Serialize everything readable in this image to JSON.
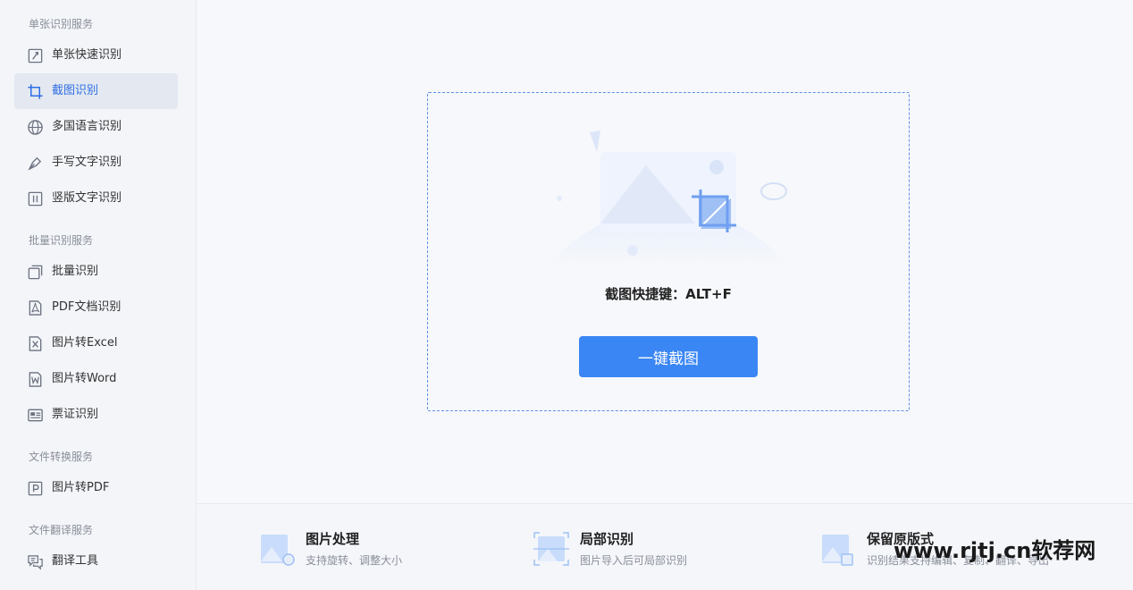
{
  "sidebar": {
    "sections": [
      {
        "title": "单张识别服务",
        "items": [
          {
            "label": "单张快速识别",
            "icon": "single-recognition-icon"
          },
          {
            "label": "截图识别",
            "icon": "crop-icon",
            "active": true
          },
          {
            "label": "多国语言识别",
            "icon": "globe-icon"
          },
          {
            "label": "手写文字识别",
            "icon": "pen-icon"
          },
          {
            "label": "竖版文字识别",
            "icon": "vertical-text-icon"
          }
        ]
      },
      {
        "title": "批量识别服务",
        "items": [
          {
            "label": "批量识别",
            "icon": "batch-icon"
          },
          {
            "label": "PDF文档识别",
            "icon": "pdf-icon"
          },
          {
            "label": "图片转Excel",
            "icon": "excel-icon"
          },
          {
            "label": "图片转Word",
            "icon": "word-icon"
          },
          {
            "label": "票证识别",
            "icon": "id-card-icon"
          }
        ]
      },
      {
        "title": "文件转换服务",
        "items": [
          {
            "label": "图片转PDF",
            "icon": "pdf-convert-icon"
          }
        ]
      },
      {
        "title": "文件翻译服务",
        "items": [
          {
            "label": "翻译工具",
            "icon": "translate-icon"
          }
        ]
      }
    ]
  },
  "main": {
    "shortcut_text": "截图快捷键：ALT+F",
    "snap_button": "一键截图"
  },
  "features": [
    {
      "title": "图片处理",
      "desc": "支持旋转、调整大小",
      "icon": "image-process-icon"
    },
    {
      "title": "局部识别",
      "desc": "图片导入后可局部识别",
      "icon": "partial-recognition-icon"
    },
    {
      "title": "保留原版式",
      "desc": "识别结果支持编辑、复制、翻译、导出",
      "icon": "keep-layout-icon"
    }
  ],
  "watermark": "www.rjtj.cn软荐网",
  "colors": {
    "accent": "#3a86f4",
    "active_text": "#2f6fe4",
    "dash_border": "#5d8fe6"
  }
}
